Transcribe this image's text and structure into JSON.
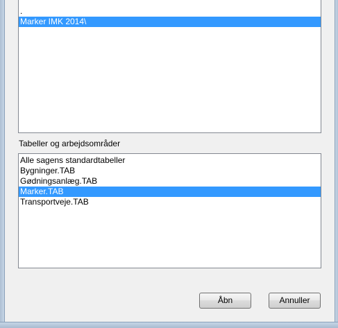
{
  "folder_list": {
    "items": [
      {
        "label": ".",
        "selected": false
      },
      {
        "label": "Marker IMK 2014\\",
        "selected": true
      }
    ]
  },
  "tables_section": {
    "label": "Tabeller og arbejdsområder",
    "items": [
      {
        "label": "Alle sagens standardtabeller",
        "selected": false
      },
      {
        "label": "Bygninger.TAB",
        "selected": false
      },
      {
        "label": "Gødningsanlæg.TAB",
        "selected": false
      },
      {
        "label": "Marker.TAB",
        "selected": true
      },
      {
        "label": "Transportveje.TAB",
        "selected": false
      }
    ]
  },
  "buttons": {
    "open_label": "Åbn",
    "cancel_label": "Annuller"
  },
  "colors": {
    "selection": "#3399ff",
    "list_border": "#828790",
    "dialog_bg": "#f0f0f0"
  }
}
